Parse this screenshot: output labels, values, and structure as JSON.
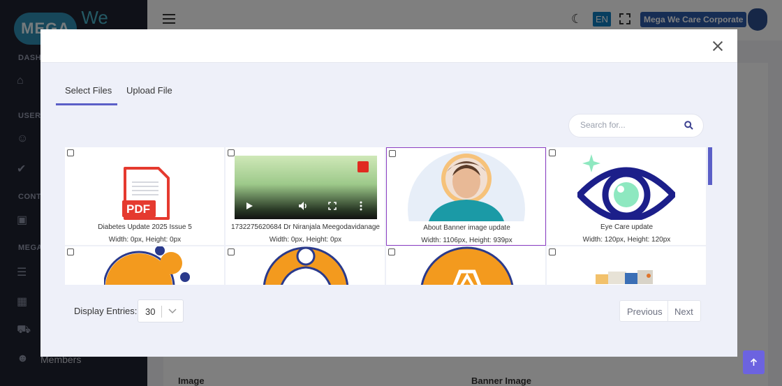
{
  "app": {
    "logo_main": "MEGA",
    "logo_sub": "We care",
    "company": "Mega We Care Corporate",
    "language": "EN"
  },
  "sidebar": {
    "sections": [
      "DASH",
      "USER",
      "CONT",
      "MEGA"
    ],
    "items": [
      {
        "label": "Members"
      }
    ]
  },
  "background": {
    "column_image": "Image",
    "column_banner": "Banner Image"
  },
  "modal": {
    "tabs": [
      "Select Files",
      "Upload File"
    ],
    "active_tab": "Select Files",
    "search": {
      "placeholder": "Search for...",
      "value": ""
    },
    "files": [
      {
        "name": "Diabetes Update 2025 Issue 5",
        "dims": "Width: 0px, Height: 0px",
        "type": "pdf",
        "selected": false
      },
      {
        "name": "1732275620684 Dr Niranjala Meegodavidanage",
        "dims": "Width: 0px, Height: 0px",
        "type": "video",
        "selected": false
      },
      {
        "name": "About Banner image update",
        "dims": "Width: 1106px, Height: 939px",
        "type": "image",
        "selected": true
      },
      {
        "name": "Eye Care update",
        "dims": "Width: 120px, Height: 120px",
        "type": "image",
        "selected": false
      },
      {
        "name": "",
        "dims": "",
        "type": "image",
        "selected": false
      },
      {
        "name": "",
        "dims": "",
        "type": "image",
        "selected": false
      },
      {
        "name": "",
        "dims": "",
        "type": "image",
        "selected": false
      },
      {
        "name": "",
        "dims": "",
        "type": "image",
        "selected": false
      }
    ],
    "thumb_labels": {
      "pdf": "PDF"
    },
    "display_entries_label": "Display Entries:",
    "display_entries_value": "30",
    "pager": {
      "previous": "Previous",
      "next": "Next"
    }
  },
  "colors": {
    "accent": "#5b5fc7",
    "selected_border": "#8d3fc2",
    "pdf_red": "#e53a2f",
    "brand_orange": "#f39a1e",
    "eye_navy": "#1c1f8a",
    "eye_mint": "#8ee8c0"
  }
}
